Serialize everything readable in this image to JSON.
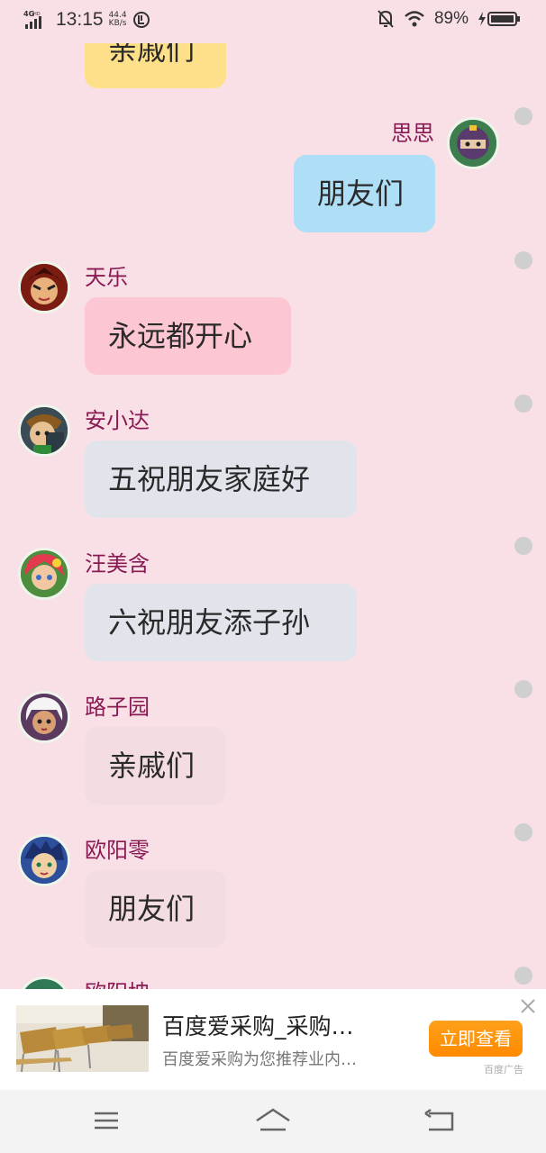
{
  "status_bar": {
    "network": "4GHD",
    "time": "13:15",
    "speed_value": "44.4",
    "speed_unit": "KB/s",
    "battery": "89%"
  },
  "messages": [
    {
      "sender": "",
      "text": "亲戚们",
      "side": "left",
      "bubble_color": "#ffe08a",
      "avatar": "partial"
    },
    {
      "sender": "思思",
      "text": "朋友们",
      "side": "right",
      "bubble_color": "#aedff6",
      "avatar": "ninja"
    },
    {
      "sender": "天乐",
      "text": "永远都开心",
      "side": "left",
      "bubble_color": "#fdc6d3",
      "avatar": "tianle"
    },
    {
      "sender": "安小达",
      "text": "五祝朋友家庭好",
      "side": "left",
      "bubble_color": "#e1e4ea",
      "avatar": "anxiaoda"
    },
    {
      "sender": "汪美含",
      "text": "六祝朋友添子孙",
      "side": "left",
      "bubble_color": "#e1e4ea",
      "avatar": "wangmeihan"
    },
    {
      "sender": "路子园",
      "text": "亲戚们",
      "side": "left",
      "bubble_color": "#f4dde0",
      "avatar": "luziyuan"
    },
    {
      "sender": "欧阳零",
      "text": "朋友们",
      "side": "left",
      "bubble_color": "#f4dde0",
      "avatar": "ouyangling"
    },
    {
      "sender": "欧阳坤",
      "text": "",
      "side": "left",
      "bubble_color": "",
      "avatar": "ouyangkun"
    }
  ],
  "ad": {
    "title": "百度爱采购_采购…",
    "description": "百度爱采购为您推荐业内…",
    "button_label": "立即查看",
    "tag": "百度广告"
  },
  "colors": {
    "background": "#f9dfe6",
    "sender_name": "#8a1a53",
    "ad_button": "#ff9500"
  }
}
